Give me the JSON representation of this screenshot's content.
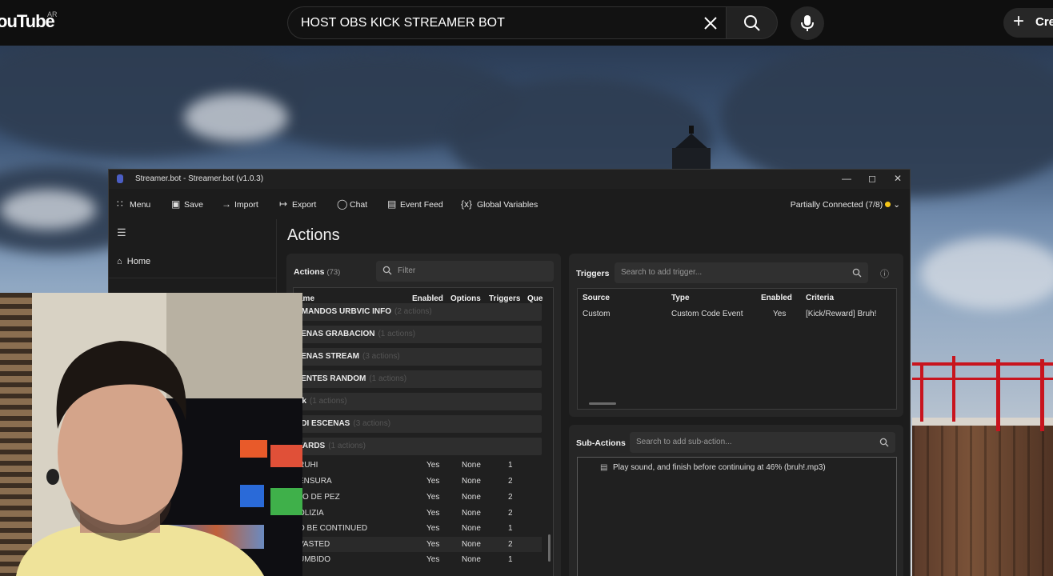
{
  "youtube": {
    "logo": "ouTube",
    "region": "AR",
    "search_value": "HOST OBS KICK STREAMER BOT",
    "create_label": "Cre"
  },
  "streamerbot": {
    "window_title": "Streamer.bot - Streamer.bot (v1.0.3)",
    "toolbar": [
      {
        "icon": "grid-icon",
        "label": "Menu"
      },
      {
        "icon": "save-icon",
        "label": "Save"
      },
      {
        "icon": "import-icon",
        "label": "Import"
      },
      {
        "icon": "export-icon",
        "label": "Export"
      },
      {
        "icon": "chat-icon",
        "label": "Chat"
      },
      {
        "icon": "event-feed-icon",
        "label": "Event Feed"
      },
      {
        "icon": "variables-icon",
        "label": "Global Variables"
      }
    ],
    "connection_status": "Partially Connected (7/8)",
    "sidebar": {
      "home": "Home"
    },
    "page_title": "Actions",
    "actions_panel": {
      "title": "Actions",
      "count": "(73)",
      "filter_placeholder": "Filter",
      "columns": [
        "ame",
        "Enabled",
        "Options",
        "Triggers",
        "Que"
      ],
      "groups": [
        {
          "name": "OMANDOS URBVIC INFO",
          "count": "(2 actions)"
        },
        {
          "name": "CENAS GRABACION",
          "count": "(1 actions)"
        },
        {
          "name": "CENAS STREAM",
          "count": "(3 actions)"
        },
        {
          "name": "UENTES RANDOM",
          "count": "(1 actions)"
        },
        {
          "name": "ick",
          "count": "(1 actions)"
        },
        {
          "name": "KDI ESCENAS",
          "count": "(3 actions)"
        },
        {
          "name": "WARDS",
          "count": "(1 actions)"
        }
      ],
      "rows": [
        {
          "name": "RUHI",
          "enabled": "Yes",
          "options": "None",
          "triggers": "1"
        },
        {
          "name": "ENSURA",
          "enabled": "Yes",
          "options": "None",
          "triggers": "2"
        },
        {
          "name": "JO DE PEZ",
          "enabled": "Yes",
          "options": "None",
          "triggers": "2"
        },
        {
          "name": "OLIZIA",
          "enabled": "Yes",
          "options": "None",
          "triggers": "2"
        },
        {
          "name": "O BE CONTINUED",
          "enabled": "Yes",
          "options": "None",
          "triggers": "1"
        },
        {
          "name": "VASTED",
          "enabled": "Yes",
          "options": "None",
          "triggers": "2"
        },
        {
          "name": "UMBIDO",
          "enabled": "Yes",
          "options": "None",
          "triggers": "1"
        }
      ]
    },
    "triggers_panel": {
      "title": "Triggers",
      "search_placeholder": "Search to add trigger...",
      "columns": [
        "Source",
        "Type",
        "Enabled",
        "Criteria"
      ],
      "rows": [
        {
          "source": "Custom",
          "type": "Custom Code Event",
          "enabled": "Yes",
          "criteria": "[Kick/Reward] Bruh!"
        }
      ]
    },
    "subactions_panel": {
      "title": "Sub-Actions",
      "search_placeholder": "Search to add sub-action...",
      "items": [
        "Play sound, and finish before continuing at 46% (bruh!.mp3)"
      ]
    }
  }
}
